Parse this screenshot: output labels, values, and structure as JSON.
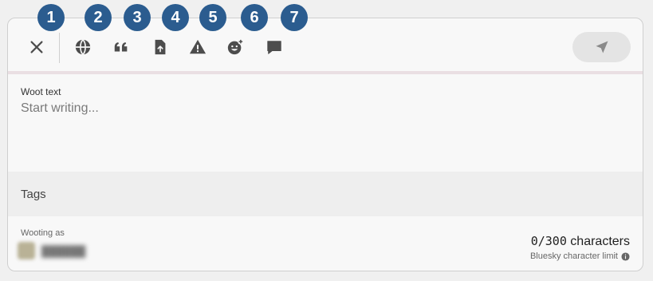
{
  "toolbar": {
    "tools": [
      {
        "name": "close-button",
        "icon": "close-icon"
      },
      {
        "name": "visibility-button",
        "icon": "globe-icon"
      },
      {
        "name": "quote-button",
        "icon": "quote-icon"
      },
      {
        "name": "upload-button",
        "icon": "file-upload-icon"
      },
      {
        "name": "content-warning-button",
        "icon": "warning-icon"
      },
      {
        "name": "emoji-button",
        "icon": "emoji-add-icon"
      },
      {
        "name": "reply-button",
        "icon": "comment-icon"
      }
    ],
    "send_icon": "send-icon",
    "icon_color": "#4d4d4d"
  },
  "markers": [
    "1",
    "2",
    "3",
    "4",
    "5",
    "6",
    "7"
  ],
  "marker_color": "#2b5c8f",
  "text": {
    "label": "Woot text",
    "placeholder": "Start writing..."
  },
  "tags": {
    "label": "Tags"
  },
  "footer": {
    "wooting_label": "Wooting as",
    "count": "0/300",
    "count_suffix": " characters",
    "limit_label": "Bluesky character limit"
  }
}
